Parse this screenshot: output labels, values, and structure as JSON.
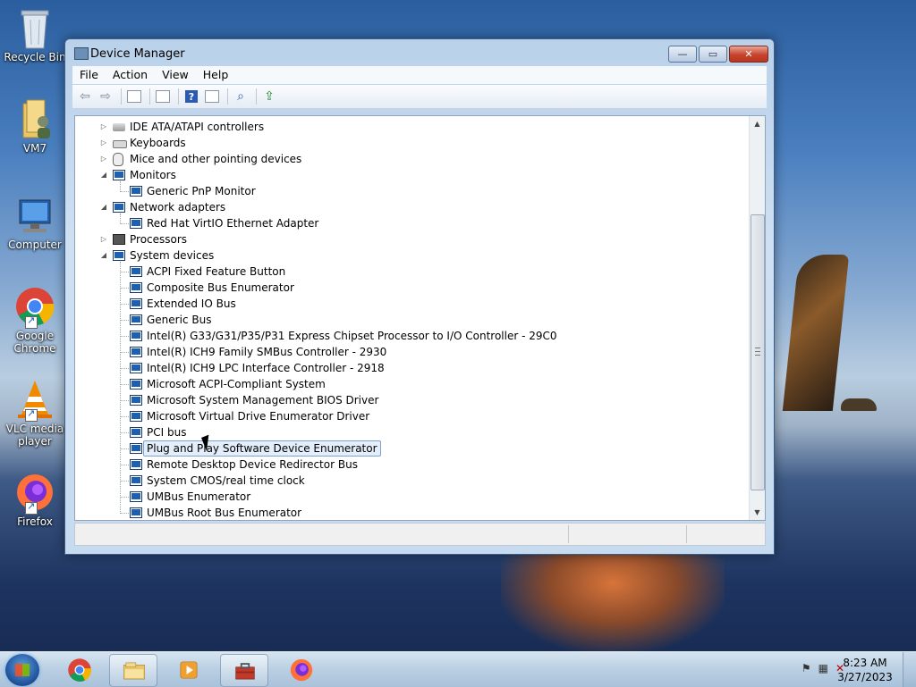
{
  "desktop": {
    "icons": [
      {
        "label": "Recycle Bin"
      },
      {
        "label": "VM7"
      },
      {
        "label": "Computer"
      },
      {
        "label": "Google Chrome"
      },
      {
        "label": "VLC media player"
      },
      {
        "label": "Firefox"
      }
    ]
  },
  "window": {
    "title": "Device Manager",
    "controls": {
      "minimize": "—",
      "maximize": "▭",
      "close": "✕"
    },
    "menu": [
      "File",
      "Action",
      "View",
      "Help"
    ]
  },
  "tree": {
    "items": [
      {
        "label": "IDE ATA/ATAPI controllers",
        "level": 0,
        "expander": "▷",
        "icon": "disk"
      },
      {
        "label": "Keyboards",
        "level": 0,
        "expander": "▷",
        "icon": "keyboard"
      },
      {
        "label": "Mice and other pointing devices",
        "level": 0,
        "expander": "▷",
        "icon": "mouse"
      },
      {
        "label": "Monitors",
        "level": 0,
        "expander": "◢",
        "icon": "monitor"
      },
      {
        "label": "Generic PnP Monitor",
        "level": 1,
        "icon": "monitor"
      },
      {
        "label": "Network adapters",
        "level": 0,
        "expander": "◢",
        "icon": "network"
      },
      {
        "label": "Red Hat VirtIO Ethernet Adapter",
        "level": 1,
        "icon": "network"
      },
      {
        "label": "Processors",
        "level": 0,
        "expander": "▷",
        "icon": "chip"
      },
      {
        "label": "System devices",
        "level": 0,
        "expander": "◢",
        "icon": "monitor"
      },
      {
        "label": "ACPI Fixed Feature Button",
        "level": 1,
        "icon": "monitor"
      },
      {
        "label": "Composite Bus Enumerator",
        "level": 1,
        "icon": "monitor"
      },
      {
        "label": "Extended IO Bus",
        "level": 1,
        "icon": "monitor"
      },
      {
        "label": "Generic Bus",
        "level": 1,
        "icon": "monitor"
      },
      {
        "label": "Intel(R) G33/G31/P35/P31 Express Chipset Processor to I/O Controller - 29C0",
        "level": 1,
        "icon": "monitor"
      },
      {
        "label": "Intel(R) ICH9 Family SMBus Controller - 2930",
        "level": 1,
        "icon": "monitor"
      },
      {
        "label": "Intel(R) ICH9 LPC Interface Controller - 2918",
        "level": 1,
        "icon": "monitor"
      },
      {
        "label": "Microsoft ACPI-Compliant System",
        "level": 1,
        "icon": "monitor"
      },
      {
        "label": "Microsoft System Management BIOS Driver",
        "level": 1,
        "icon": "monitor"
      },
      {
        "label": "Microsoft Virtual Drive Enumerator Driver",
        "level": 1,
        "icon": "monitor"
      },
      {
        "label": "PCI bus",
        "level": 1,
        "icon": "monitor"
      },
      {
        "label": "Plug and Play Software Device Enumerator",
        "level": 1,
        "icon": "monitor",
        "selected": true
      },
      {
        "label": "Remote Desktop Device Redirector Bus",
        "level": 1,
        "icon": "monitor"
      },
      {
        "label": "System CMOS/real time clock",
        "level": 1,
        "icon": "monitor"
      },
      {
        "label": "UMBus Enumerator",
        "level": 1,
        "icon": "monitor"
      },
      {
        "label": "UMBus Root Bus Enumerator",
        "level": 1,
        "icon": "monitor"
      }
    ]
  },
  "taskbar": {
    "clock_time": "8:23 AM",
    "clock_date": "3/27/2023"
  },
  "colors": {
    "selection_fill": "#e4eefb",
    "selection_border": "#7da2ce",
    "close_button": "#c7432e"
  }
}
